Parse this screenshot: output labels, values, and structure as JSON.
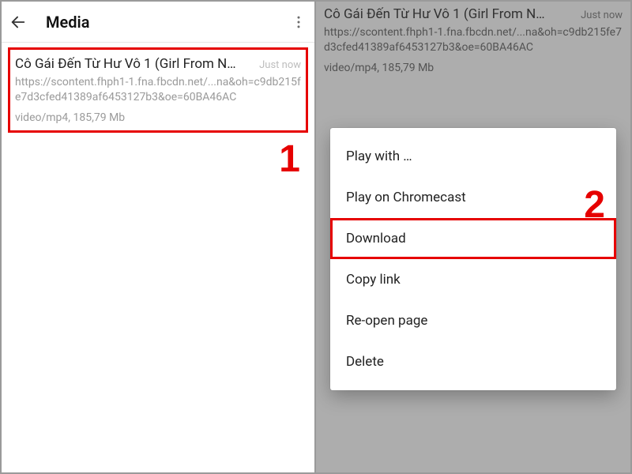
{
  "colors": {
    "highlight": "#e60000"
  },
  "left": {
    "title": "Media",
    "card": {
      "title": "Cô Gái Đến Từ Hư Vô 1 (Girl From N…",
      "time": "Just now",
      "url": "https://scontent.fhph1-1.fna.fbcdn.net/...na&oh=c9db215fe7d3cfed41389af6453127b3&oe=60BA46AC",
      "meta": "video/mp4, 185,79 Mb"
    },
    "step_label": "1"
  },
  "right": {
    "card": {
      "title": "Cô Gái Đến Từ Hư Vô 1 (Girl From N…",
      "time": "Just now",
      "url": "https://scontent.fhph1-1.fna.fbcdn.net/...na&oh=c9db215fe7d3cfed41389af6453127b3&oe=60BA46AC",
      "meta": "video/mp4, 185,79 Mb"
    },
    "menu": {
      "items": [
        {
          "label": "Play with …"
        },
        {
          "label": "Play on Chromecast"
        },
        {
          "label": "Download"
        },
        {
          "label": "Copy link"
        },
        {
          "label": "Re-open page"
        },
        {
          "label": "Delete"
        }
      ],
      "highlight_index": 2
    },
    "step_label": "2"
  }
}
